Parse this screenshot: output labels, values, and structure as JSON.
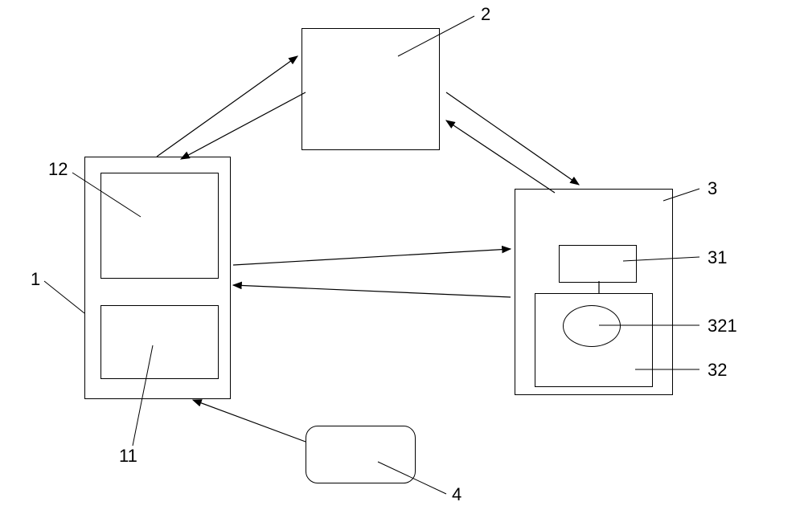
{
  "diagram": {
    "blocks": {
      "box1": {
        "id": "1",
        "label": "1"
      },
      "box1_inner_top": {
        "id": "12",
        "label": "12"
      },
      "box1_inner_bottom": {
        "id": "11",
        "label": "11"
      },
      "box2": {
        "id": "2",
        "label": "2"
      },
      "box3": {
        "id": "3",
        "label": "3"
      },
      "box3_inner_top": {
        "id": "31",
        "label": "31"
      },
      "box3_inner_bottom": {
        "id": "32",
        "label": "32"
      },
      "box3_ellipse": {
        "id": "321",
        "label": "321"
      },
      "box4": {
        "id": "4",
        "label": "4"
      }
    },
    "connections": [
      {
        "from": "1",
        "to": "2",
        "type": "bidirectional"
      },
      {
        "from": "2",
        "to": "3",
        "type": "bidirectional"
      },
      {
        "from": "1",
        "to": "3",
        "type": "bidirectional"
      },
      {
        "from": "4",
        "to": "1",
        "type": "unidirectional"
      }
    ]
  },
  "chart_data": {
    "type": "diagram",
    "description": "Block diagram with numbered components and bidirectional/unidirectional arrows",
    "nodes": [
      {
        "id": "1",
        "contains": [
          "11",
          "12"
        ]
      },
      {
        "id": "2"
      },
      {
        "id": "3",
        "contains": [
          "31",
          "32"
        ]
      },
      {
        "id": "32",
        "contains": [
          "321"
        ]
      },
      {
        "id": "4"
      }
    ],
    "edges": [
      {
        "from": "1",
        "to": "2",
        "bidirectional": true
      },
      {
        "from": "2",
        "to": "3",
        "bidirectional": true
      },
      {
        "from": "1",
        "to": "3",
        "bidirectional": true
      },
      {
        "from": "4",
        "to": "1",
        "bidirectional": false
      }
    ]
  }
}
